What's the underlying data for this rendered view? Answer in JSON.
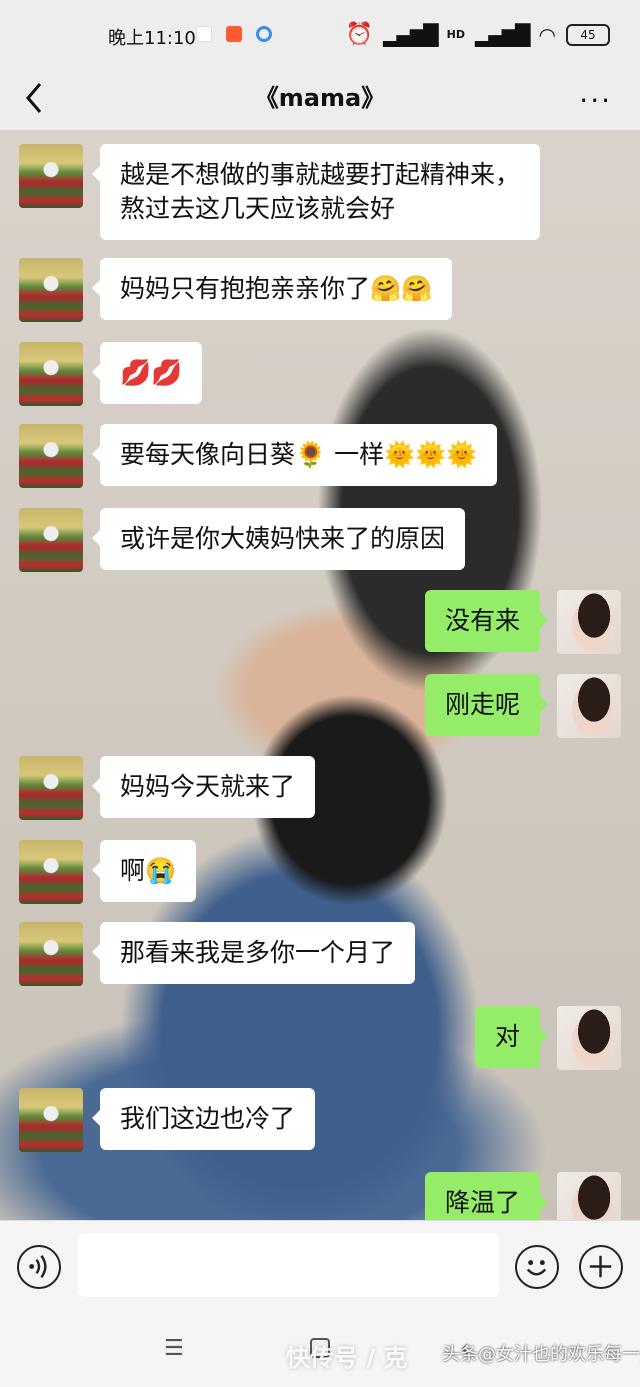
{
  "status_bar": {
    "time": "晚上11:10",
    "battery": "45",
    "network_label": "HD"
  },
  "header": {
    "title": "《mama》",
    "more": "···"
  },
  "messages": [
    {
      "side": "left",
      "text": "越是不想做的事就越要打起精神来，熬过去这几天应该就会好"
    },
    {
      "side": "left",
      "text": "妈妈只有抱抱亲亲你了🤗🤗"
    },
    {
      "side": "left",
      "text": "💋💋"
    },
    {
      "side": "left",
      "text": "要每天像向日葵🌻 一样🌞🌞🌞"
    },
    {
      "side": "left",
      "text": "或许是你大姨妈快来了的原因"
    },
    {
      "side": "right",
      "text": "没有来"
    },
    {
      "side": "right",
      "text": "刚走呢"
    },
    {
      "side": "left",
      "text": "妈妈今天就来了"
    },
    {
      "side": "left",
      "text": "啊😭"
    },
    {
      "side": "left",
      "text": "那看来我是多你一个月了"
    },
    {
      "side": "right",
      "text": "对"
    },
    {
      "side": "left",
      "text": "我们这边也冷了"
    },
    {
      "side": "right",
      "text": "降温了"
    }
  ],
  "input_bar": {
    "placeholder": ""
  },
  "watermark": {
    "main": "快传号 / 克",
    "sub": "头条@女汁也的欢乐每一天"
  }
}
